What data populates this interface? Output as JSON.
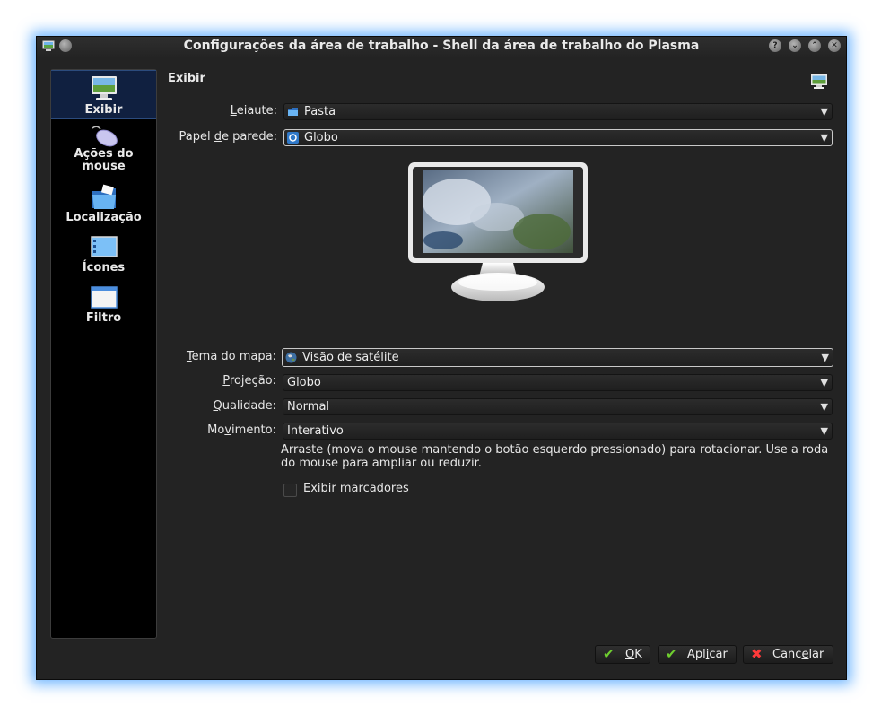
{
  "window": {
    "title": "Configurações da área de trabalho - Shell da área de trabalho do Plasma"
  },
  "titlebar_buttons": [
    {
      "name": "help-icon",
      "glyph": "?"
    },
    {
      "name": "minimize-icon",
      "glyph": "⌄"
    },
    {
      "name": "maximize-icon",
      "glyph": "⌃"
    },
    {
      "name": "close-icon",
      "glyph": "✕"
    }
  ],
  "sidebar": {
    "items": [
      {
        "label": "Exibir",
        "icon": "monitor-icon",
        "active": true
      },
      {
        "label": "Ações do mouse",
        "icon": "mouse-icon",
        "active": false
      },
      {
        "label": "Localização",
        "icon": "folder-icon",
        "active": false
      },
      {
        "label": "Ícones",
        "icon": "icons-window-icon",
        "active": false
      },
      {
        "label": "Filtro",
        "icon": "filter-window-icon",
        "active": false
      }
    ]
  },
  "main": {
    "title": "Exibir",
    "layout": {
      "label_pre": "",
      "label_u": "L",
      "label_post": "eiaute:",
      "value": "Pasta"
    },
    "wallpaper": {
      "label_pre": "Papel ",
      "label_u": "d",
      "label_post": "e parede:",
      "value": "Globo"
    },
    "map_theme": {
      "label_pre": "",
      "label_u": "T",
      "label_post": "ema do mapa:",
      "value": "Visão de satélite"
    },
    "projection": {
      "label_pre": "",
      "label_u": "P",
      "label_post": "rojeção:",
      "value": "Globo"
    },
    "quality": {
      "label_pre": "",
      "label_u": "Q",
      "label_post": "ualidade:",
      "value": "Normal"
    },
    "movement": {
      "label_pre": "Mo",
      "label_u": "v",
      "label_post": "imento:",
      "value": "Interativo"
    },
    "help_text": "Arraste (mova o mouse mantendo o botão esquerdo pressionado) para rotacionar. Use a roda do mouse para ampliar ou reduzir.",
    "show_markers": {
      "label_pre": "Exibir ",
      "label_u": "m",
      "label_post": "arcadores",
      "checked": false
    }
  },
  "buttons": {
    "ok": {
      "pre": "",
      "u": "O",
      "post": "K"
    },
    "apply": {
      "pre": "Apl",
      "u": "i",
      "post": "car"
    },
    "cancel": {
      "pre": "Canc",
      "u": "e",
      "post": "lar"
    }
  },
  "colors": {
    "window_bg": "#232323",
    "sidebar_bg": "#000000",
    "active_item": "#102040",
    "glow": "#46a0ff"
  }
}
